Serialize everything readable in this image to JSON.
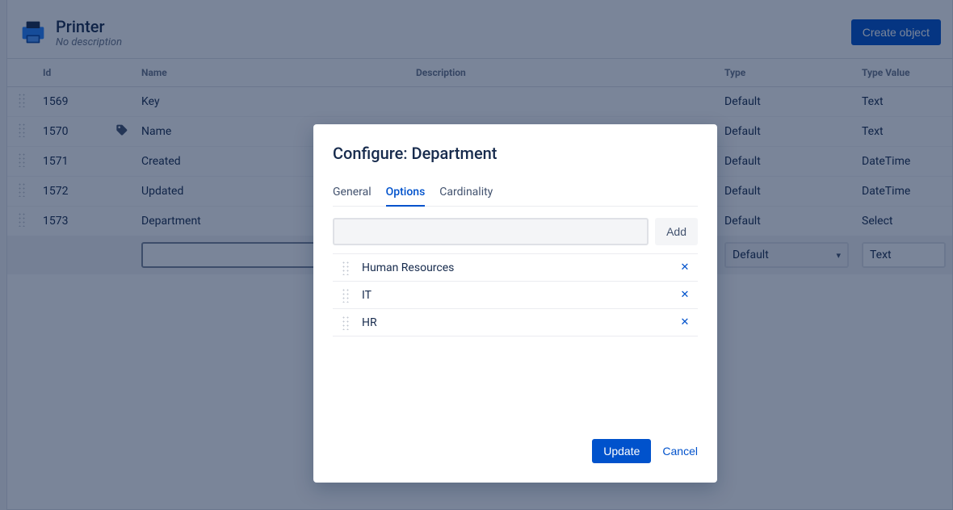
{
  "header": {
    "title": "Printer",
    "subtitle": "No description",
    "create_label": "Create object"
  },
  "table": {
    "columns": {
      "id": "Id",
      "name": "Name",
      "description": "Description",
      "type": "Type",
      "type_value": "Type Value"
    },
    "rows": [
      {
        "id": "1569",
        "name": "Key",
        "type": "Default",
        "type_value": "Text",
        "has_tag": false
      },
      {
        "id": "1570",
        "name": "Name",
        "type": "Default",
        "type_value": "Text",
        "has_tag": true
      },
      {
        "id": "1571",
        "name": "Created",
        "type": "Default",
        "type_value": "DateTime",
        "has_tag": false
      },
      {
        "id": "1572",
        "name": "Updated",
        "type": "Default",
        "type_value": "DateTime",
        "has_tag": false
      },
      {
        "id": "1573",
        "name": "Department",
        "type": "Default",
        "type_value": "Select",
        "has_tag": false
      }
    ],
    "editor": {
      "type_value": "Default",
      "type_value_right": "Text"
    }
  },
  "modal": {
    "title": "Configure: Department",
    "tabs": {
      "general": "General",
      "options": "Options",
      "cardinality": "Cardinality"
    },
    "add_label": "Add",
    "options": [
      {
        "label": "Human Resources"
      },
      {
        "label": "IT"
      },
      {
        "label": "HR"
      }
    ],
    "update_label": "Update",
    "cancel_label": "Cancel"
  }
}
